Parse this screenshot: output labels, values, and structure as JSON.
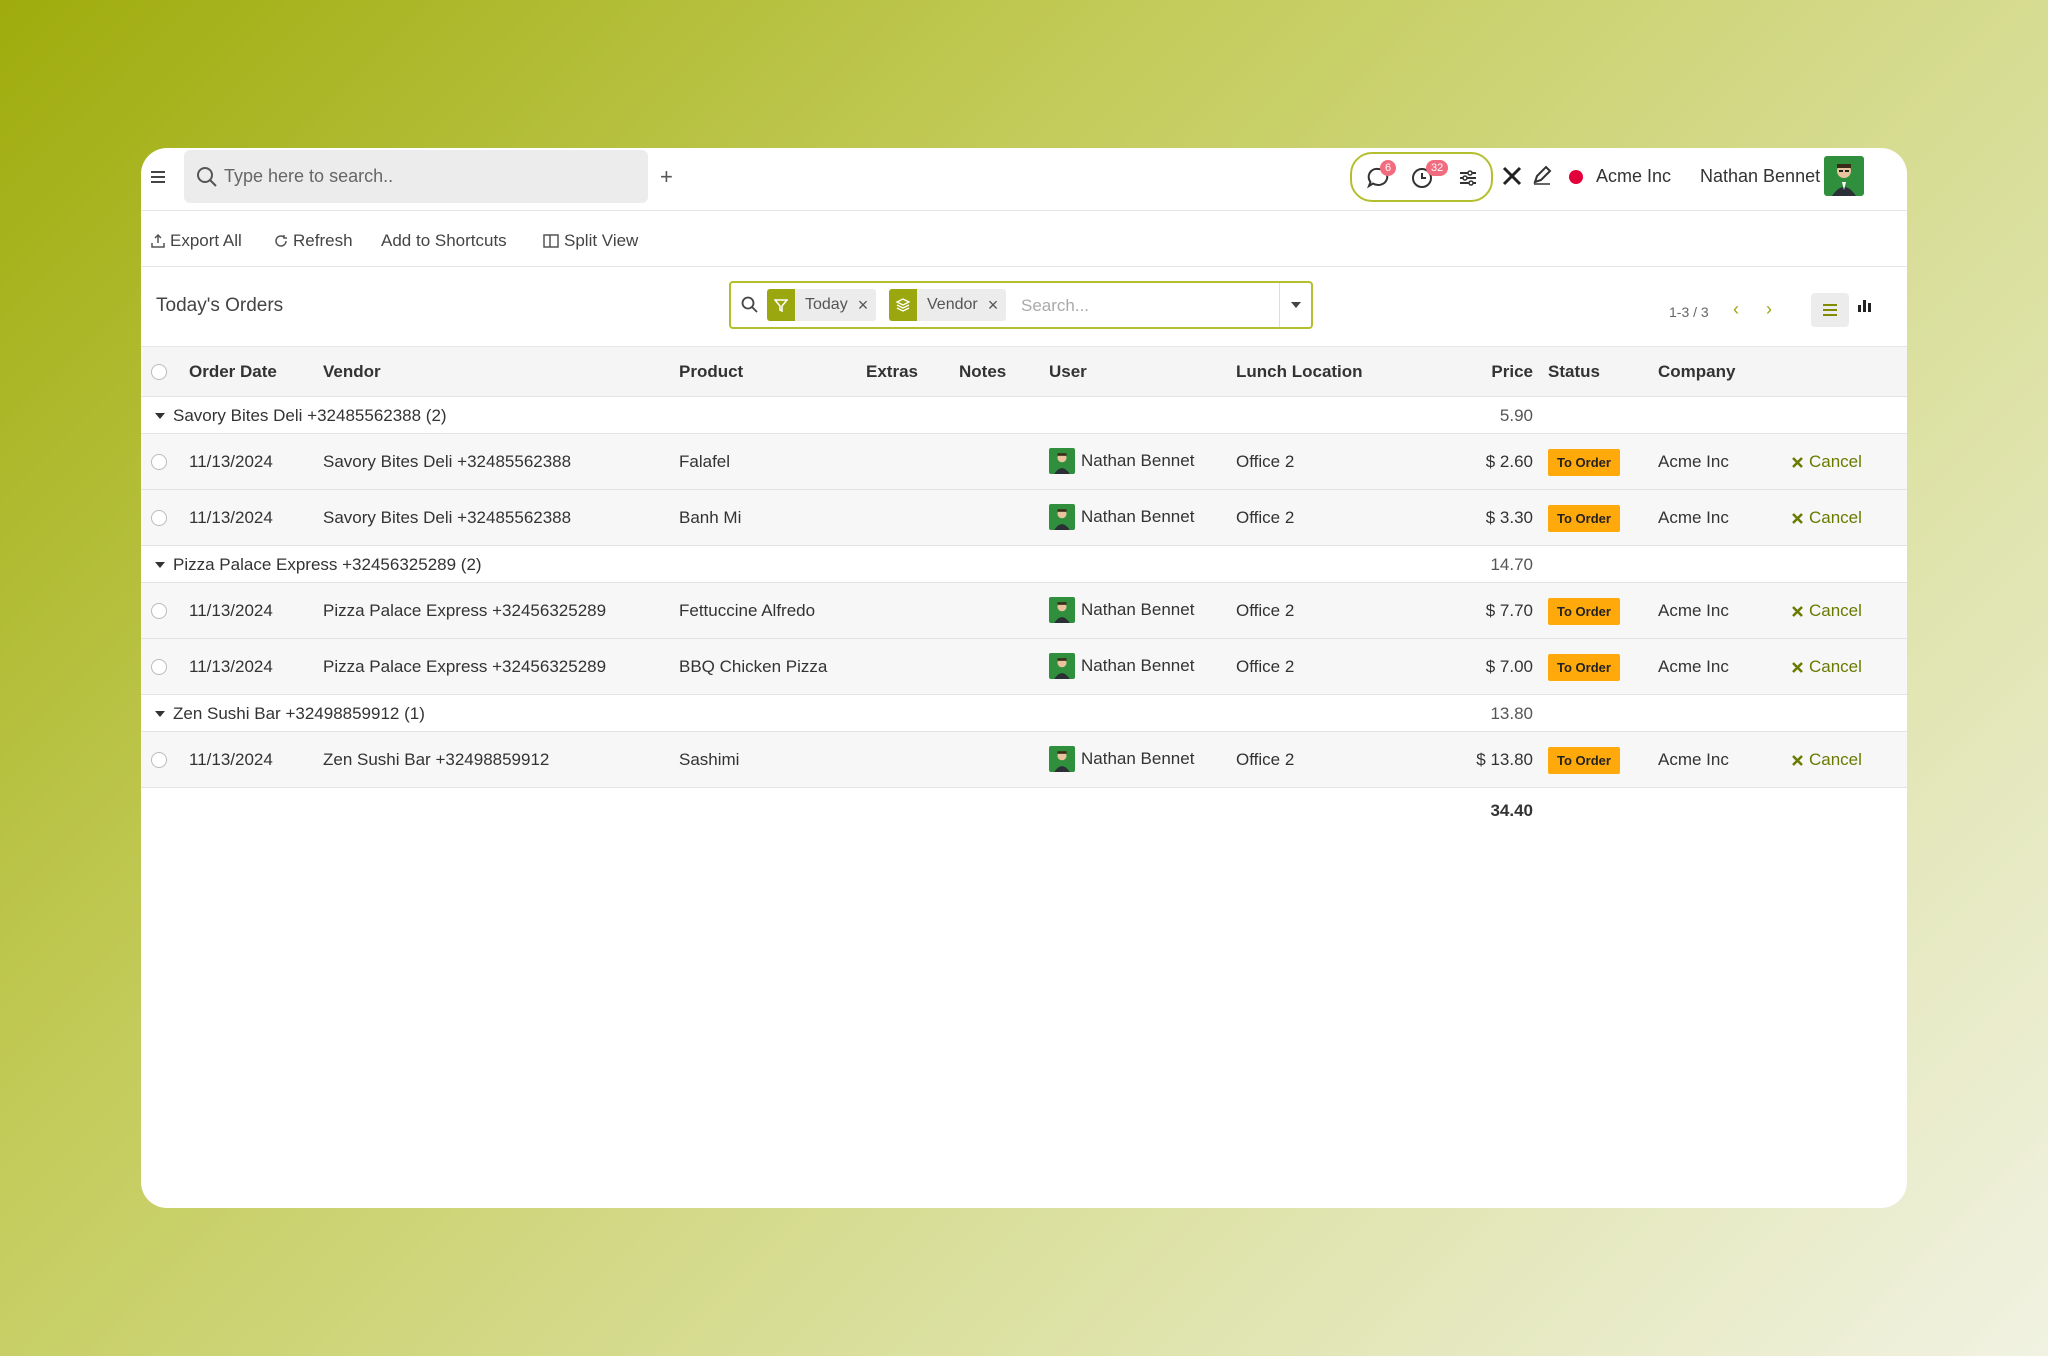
{
  "topbar": {
    "search_placeholder": "Type here to search..",
    "add_label": "+",
    "messages_badge": "6",
    "activities_badge": "32",
    "company": "Acme Inc",
    "user": "Nathan Bennet"
  },
  "toolbar": {
    "export_label": "Export All",
    "refresh_label": "Refresh",
    "shortcuts_label": "Add to Shortcuts",
    "split_label": "Split View"
  },
  "view": {
    "title": "Today's Orders",
    "filter_facet": "Today",
    "group_facet": "Vendor",
    "search_placeholder": "Search...",
    "pager": "1-3 / 3"
  },
  "table": {
    "headers": {
      "order_date": "Order Date",
      "vendor": "Vendor",
      "product": "Product",
      "extras": "Extras",
      "notes": "Notes",
      "user": "User",
      "location": "Lunch Location",
      "price": "Price",
      "status": "Status",
      "company": "Company"
    },
    "groups": [
      {
        "label": "Savory Bites Deli +32485562388 (2)",
        "total": "5.90",
        "rows": [
          {
            "date": "11/13/2024",
            "vendor": "Savory Bites Deli +32485562388",
            "product": "Falafel",
            "user": "Nathan Bennet",
            "location": "Office 2",
            "price": "$ 2.60",
            "status": "To Order",
            "company": "Acme Inc",
            "action": "Cancel"
          },
          {
            "date": "11/13/2024",
            "vendor": "Savory Bites Deli +32485562388",
            "product": "Banh Mi",
            "user": "Nathan Bennet",
            "location": "Office 2",
            "price": "$ 3.30",
            "status": "To Order",
            "company": "Acme Inc",
            "action": "Cancel"
          }
        ]
      },
      {
        "label": "Pizza Palace Express +32456325289 (2)",
        "total": "14.70",
        "rows": [
          {
            "date": "11/13/2024",
            "vendor": "Pizza Palace Express +32456325289",
            "product": "Fettuccine Alfredo",
            "user": "Nathan Bennet",
            "location": "Office 2",
            "price": "$ 7.70",
            "status": "To Order",
            "company": "Acme Inc",
            "action": "Cancel"
          },
          {
            "date": "11/13/2024",
            "vendor": "Pizza Palace Express +32456325289",
            "product": "BBQ Chicken Pizza",
            "user": "Nathan Bennet",
            "location": "Office 2",
            "price": "$ 7.00",
            "status": "To Order",
            "company": "Acme Inc",
            "action": "Cancel"
          }
        ]
      },
      {
        "label": "Zen Sushi Bar +32498859912 (1)",
        "total": "13.80",
        "rows": [
          {
            "date": "11/13/2024",
            "vendor": "Zen Sushi Bar +32498859912",
            "product": "Sashimi",
            "user": "Nathan Bennet",
            "location": "Office 2",
            "price": "$ 13.80",
            "status": "To Order",
            "company": "Acme Inc",
            "action": "Cancel"
          }
        ]
      }
    ],
    "grand_total": "34.40"
  },
  "colors": {
    "accent": "#9aa70e",
    "status_badge": "#ffa90a",
    "status_dot": "#e3003a",
    "notif_badge": "#f26b7f"
  }
}
